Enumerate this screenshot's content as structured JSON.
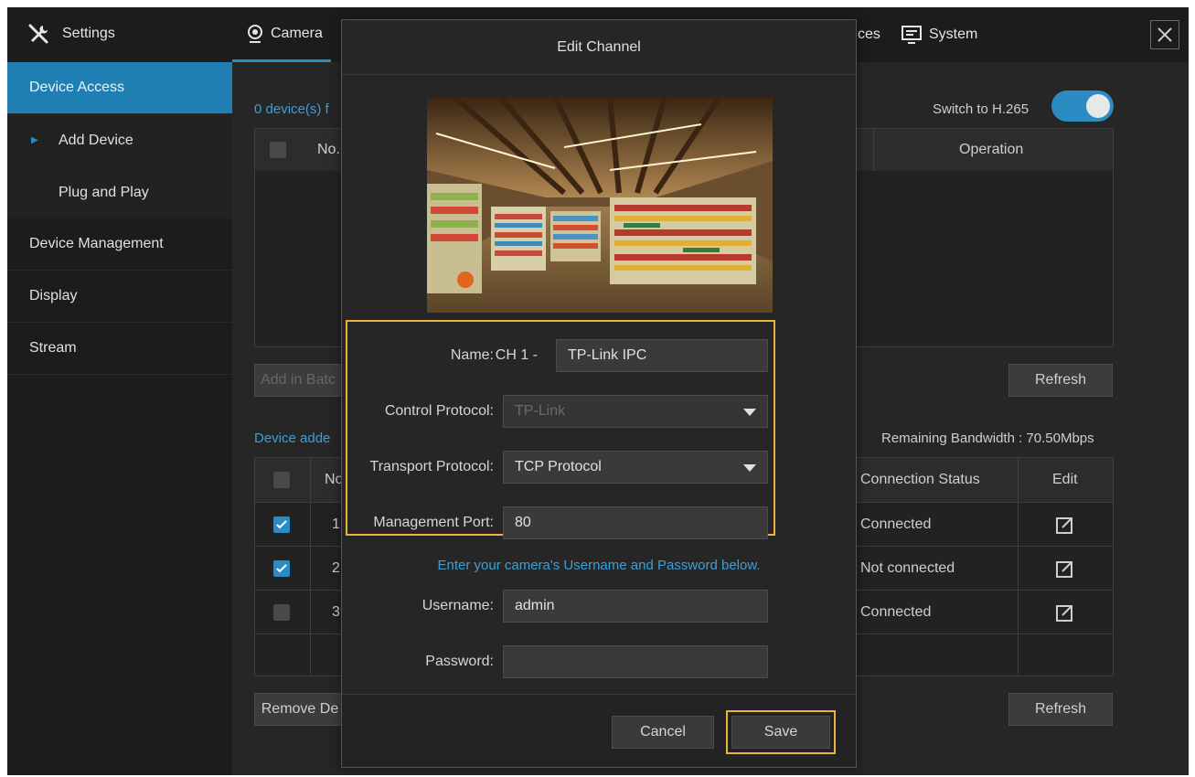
{
  "topbar": {
    "settings_label": "Settings",
    "tabs": [
      {
        "label": "Camera",
        "icon": "camera-icon"
      },
      {
        "label": "ces",
        "icon": ""
      },
      {
        "label": "System",
        "icon": "monitor-icon"
      }
    ]
  },
  "sidebar": {
    "items": [
      {
        "label": "Device Access"
      },
      {
        "label": "Add Device"
      },
      {
        "label": "Plug and Play"
      },
      {
        "label": "Device Management"
      },
      {
        "label": "Display"
      },
      {
        "label": "Stream"
      }
    ]
  },
  "main": {
    "found_text": "0 device(s) f",
    "switch_label": "Switch to H.265",
    "found_table": {
      "headers": [
        "No.",
        "Operation"
      ]
    },
    "add_batch_label": "Add in Batc",
    "refresh_label": "Refresh",
    "added_text": "Device adde",
    "bandwidth_text": "Remaining Bandwidth : 70.50Mbps",
    "added_table": {
      "headers": [
        "No",
        "Connection Status",
        "Edit"
      ],
      "rows": [
        {
          "no": "1",
          "status": "Connected",
          "checked": true
        },
        {
          "no": "2",
          "status": "Not connected",
          "checked": true
        },
        {
          "no": "3",
          "status": "Connected",
          "checked": false
        }
      ]
    },
    "remove_label": "Remove De",
    "refresh2_label": "Refresh"
  },
  "modal": {
    "title": "Edit Channel",
    "name_label": "Name:",
    "name_prefix": "CH 1 -",
    "name_value": "TP-Link IPC",
    "control_label": "Control Protocol:",
    "control_value": "TP-Link",
    "transport_label": "Transport Protocol:",
    "transport_value": "TCP Protocol",
    "port_label": "Management Port:",
    "port_value": "80",
    "hint": "Enter your camera's Username and Password below.",
    "username_label": "Username:",
    "username_value": "admin",
    "password_label": "Password:",
    "password_value": "",
    "cancel_label": "Cancel",
    "save_label": "Save"
  },
  "colors": {
    "accent": "#2b8cc4",
    "highlight": "#e6b53a",
    "background": "#262626",
    "sidebar": "#1c1c1c"
  }
}
